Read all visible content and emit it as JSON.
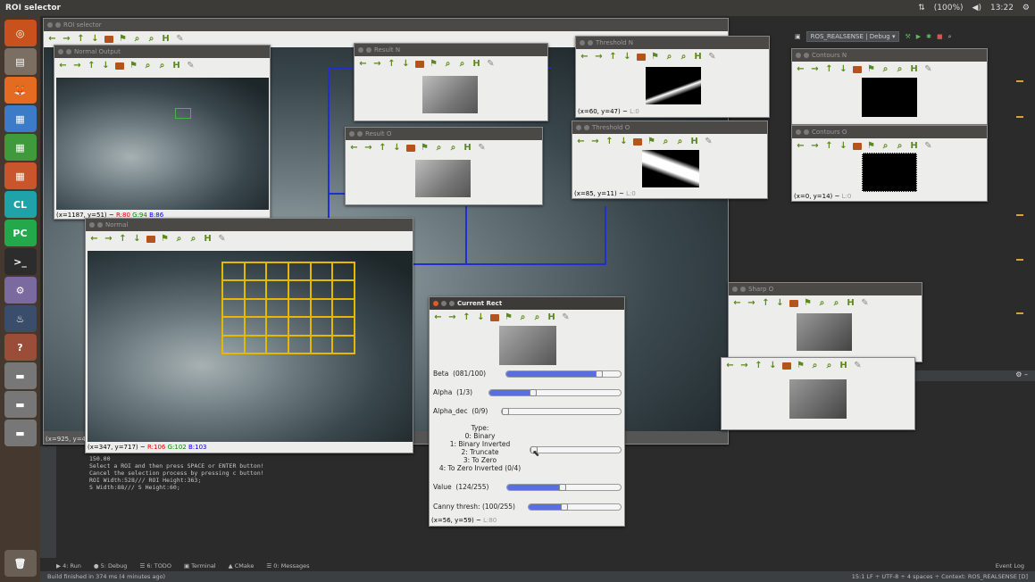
{
  "topbar": {
    "title": "ROI selector",
    "battery": "(100%)",
    "volume": "◀)",
    "time": "13:22"
  },
  "launcher": {
    "items": [
      "◎",
      "▤",
      "🦊",
      "▦",
      "▦",
      "▦",
      "CL",
      "PC",
      ">_",
      "⚙",
      "♨",
      "?",
      "▬",
      "▬",
      "▬",
      "🗑"
    ]
  },
  "ide": {
    "run_config": "ROS_REALSENSE | Debug ▾",
    "console_lines": [
      "150.00",
      "Select a ROI and then press SPACE or ENTER button!",
      "Cancel the selection process by pressing c button!",
      "ROI Width:528/// ROI Height:363;",
      "S Width:88/// S Height:60;"
    ],
    "bottom_tabs": [
      "▶ 4: Run",
      "● 5: Debug",
      "☰ 6: TODO",
      "▣ Terminal",
      "▲ CMake",
      "☰ 0: Messages"
    ],
    "event_log": "Event Log",
    "status_left": "Build finished in 374 ms (4 minutes ago)",
    "status_right": "15:1  LF ÷  UTF-8 ÷  4 spaces ÷  Context: ROS_REALSENSE [D]"
  },
  "windows": {
    "roi_selector": {
      "title": "ROI selector",
      "coord": "(x=925, y=4"
    },
    "normal_output": {
      "title": "Normal Output",
      "coord": "(x=1187, y=51) ~",
      "r": "R:80",
      "g": "G:94",
      "b": "B:86"
    },
    "normal": {
      "title": "Normal",
      "coord": "(x=347, y=717) ~",
      "r": "R:106",
      "g": "G:102",
      "b": "B:103"
    },
    "result_n": {
      "title": "Result N"
    },
    "result_o": {
      "title": "Result O"
    },
    "threshold_n": {
      "title": "Threshold N",
      "coord": "(x=60, y=47) ~",
      "dim": "L:0"
    },
    "threshold_o": {
      "title": "Threshold O",
      "coord": "(x=85, y=11) ~",
      "dim": "L:0"
    },
    "contours_n": {
      "title": "Contours N"
    },
    "contours_o": {
      "title": "Contours O",
      "coord": "(x=0, y=14) ~",
      "dim": "L:0"
    },
    "sharp_o": {
      "title": "Sharp O"
    },
    "current_rect": {
      "title": "Current Rect",
      "beta": {
        "label": "Beta",
        "value": "(081/100)",
        "fraction": 0.81
      },
      "alpha": {
        "label": "Alpha",
        "value": "(1/3)",
        "fraction": 0.33
      },
      "alpha_dec": {
        "label": "Alpha_dec",
        "value": "(0/9)",
        "fraction": 0.0
      },
      "type_text": [
        "Type:",
        "0: Binary",
        "1: Binary Inverted",
        "2: Truncate",
        "3: To Zero",
        "4: To Zero Inverted (0/4)"
      ],
      "type": {
        "fraction": 0.0
      },
      "value": {
        "label": "Value",
        "value": "(124/255)",
        "fraction": 0.49
      },
      "canny": {
        "label": "Canny thresh:",
        "value": "(100/255)",
        "fraction": 0.39
      },
      "coord": "(x=56, y=59) ~",
      "dim": "L:80"
    }
  },
  "toolbar_icons": [
    "←",
    "→",
    "↑",
    "↓",
    "save",
    "pin",
    "zoom-in",
    "zoom-out",
    "save-as",
    "tool"
  ],
  "colors": {
    "accent_blue": "#2030d0",
    "grid_yellow": "#e6b800",
    "fill_blue": "#5a6ee0"
  }
}
